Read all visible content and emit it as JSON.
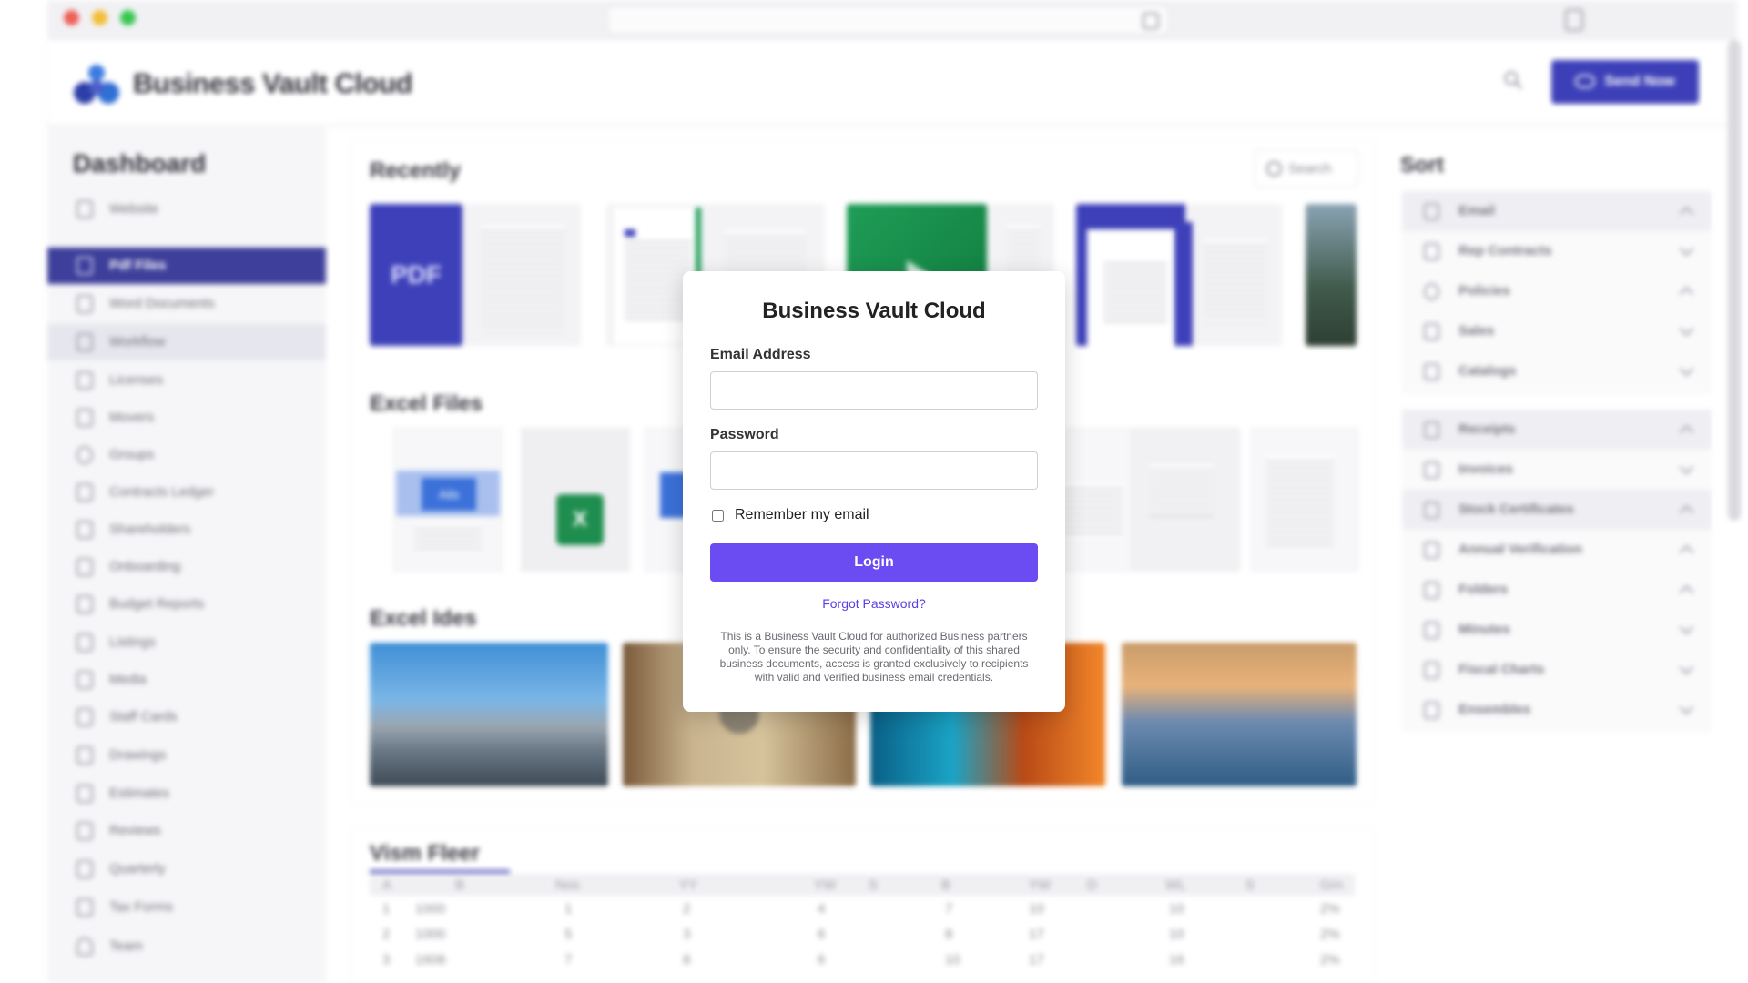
{
  "app": {
    "brand_name": "Business Vault Cloud",
    "header_button_label": "Send Now",
    "accent_color": "#3c3fb8"
  },
  "sidebar": {
    "title": "Dashboard",
    "items": [
      {
        "label": "Website",
        "icon": "file-icon"
      },
      {
        "label": "Pdf Files",
        "icon": "pdf-icon",
        "active": true
      },
      {
        "label": "Word Documents",
        "icon": "file-icon"
      },
      {
        "label": "Workflow",
        "icon": "file-icon"
      },
      {
        "label": "Licenses",
        "icon": "file-icon"
      },
      {
        "label": "Movers",
        "icon": "file-icon"
      },
      {
        "label": "Groups",
        "icon": "info-icon"
      },
      {
        "label": "Contracts Ledger",
        "icon": "grid-icon"
      },
      {
        "label": "Shareholders",
        "icon": "file-icon"
      },
      {
        "label": "Onboarding",
        "icon": "file-icon"
      },
      {
        "label": "Budget Reports",
        "icon": "file-icon"
      },
      {
        "label": "Listings",
        "icon": "calendar-icon"
      },
      {
        "label": "Media",
        "icon": "file-icon"
      },
      {
        "label": "Staff Cards",
        "icon": "grid-icon"
      },
      {
        "label": "Drawings",
        "icon": "file-icon"
      },
      {
        "label": "Estimates",
        "icon": "calendar-icon"
      },
      {
        "label": "Reviews",
        "icon": "file-icon"
      },
      {
        "label": "Quarterly",
        "icon": "info-icon"
      },
      {
        "label": "Tax Forms",
        "icon": "file-icon"
      },
      {
        "label": "Team",
        "icon": "users-icon"
      }
    ]
  },
  "main": {
    "sections": {
      "recent_title": "Recently",
      "excel_files_title": "Excel Files",
      "excel_media_title": "Excel Ides",
      "table_title": "Vism Fleer"
    },
    "search_label": "Search",
    "pdf_card_label": "PDF",
    "excel_card_label": "X",
    "word_card_label": "Ails",
    "table": {
      "headers": [
        "A",
        "B",
        "Nos",
        "YY",
        "YW",
        "S",
        "B",
        "YW",
        "D",
        "WL",
        "S",
        "Grn"
      ],
      "rows": [
        [
          "1",
          "1000",
          "1",
          "2",
          "4",
          "7",
          "10",
          "10",
          "2%"
        ],
        [
          "2",
          "1000",
          "5",
          "3",
          "6",
          "8",
          "17",
          "10",
          "2%"
        ],
        [
          "3",
          "1608",
          "7",
          "8",
          "6",
          "10",
          "17",
          "16",
          "2%"
        ]
      ]
    }
  },
  "sort_panel": {
    "title": "Sort",
    "groups": [
      [
        {
          "label": "Email",
          "chevron": "up"
        },
        {
          "label": "Rep Contracts",
          "chevron": "down"
        },
        {
          "label": "Policies",
          "chevron": "up"
        },
        {
          "label": "Sales",
          "chevron": "down"
        },
        {
          "label": "Catalogs",
          "chevron": "down"
        }
      ],
      [
        {
          "label": "Receipts",
          "chevron": "up"
        },
        {
          "label": "Invoices",
          "chevron": "down"
        },
        {
          "label": "Stock Certificates",
          "chevron": "up"
        },
        {
          "label": "Annual Verification",
          "chevron": "up"
        },
        {
          "label": "Folders",
          "chevron": "up"
        },
        {
          "label": "Minutes",
          "chevron": "down"
        },
        {
          "label": "Fiscal Charts",
          "chevron": "down"
        },
        {
          "label": "Ensembles",
          "chevron": "down"
        }
      ]
    ]
  },
  "login": {
    "title": "Business Vault Cloud",
    "email_label": "Email Address",
    "email_value": "",
    "password_label": "Password",
    "password_value": "",
    "remember_label": "Remember my email",
    "remember_checked": false,
    "login_button": "Login",
    "forgot_link": "Forgot Password?",
    "notice": "This is a Business Vault Cloud for authorized Business partners only. To ensure the security and confidentiality of this shared business documents, access is granted exclusively to recipients with valid and verified business email credentials.",
    "button_color": "#6a4cf2",
    "link_color": "#5b3fe6"
  }
}
